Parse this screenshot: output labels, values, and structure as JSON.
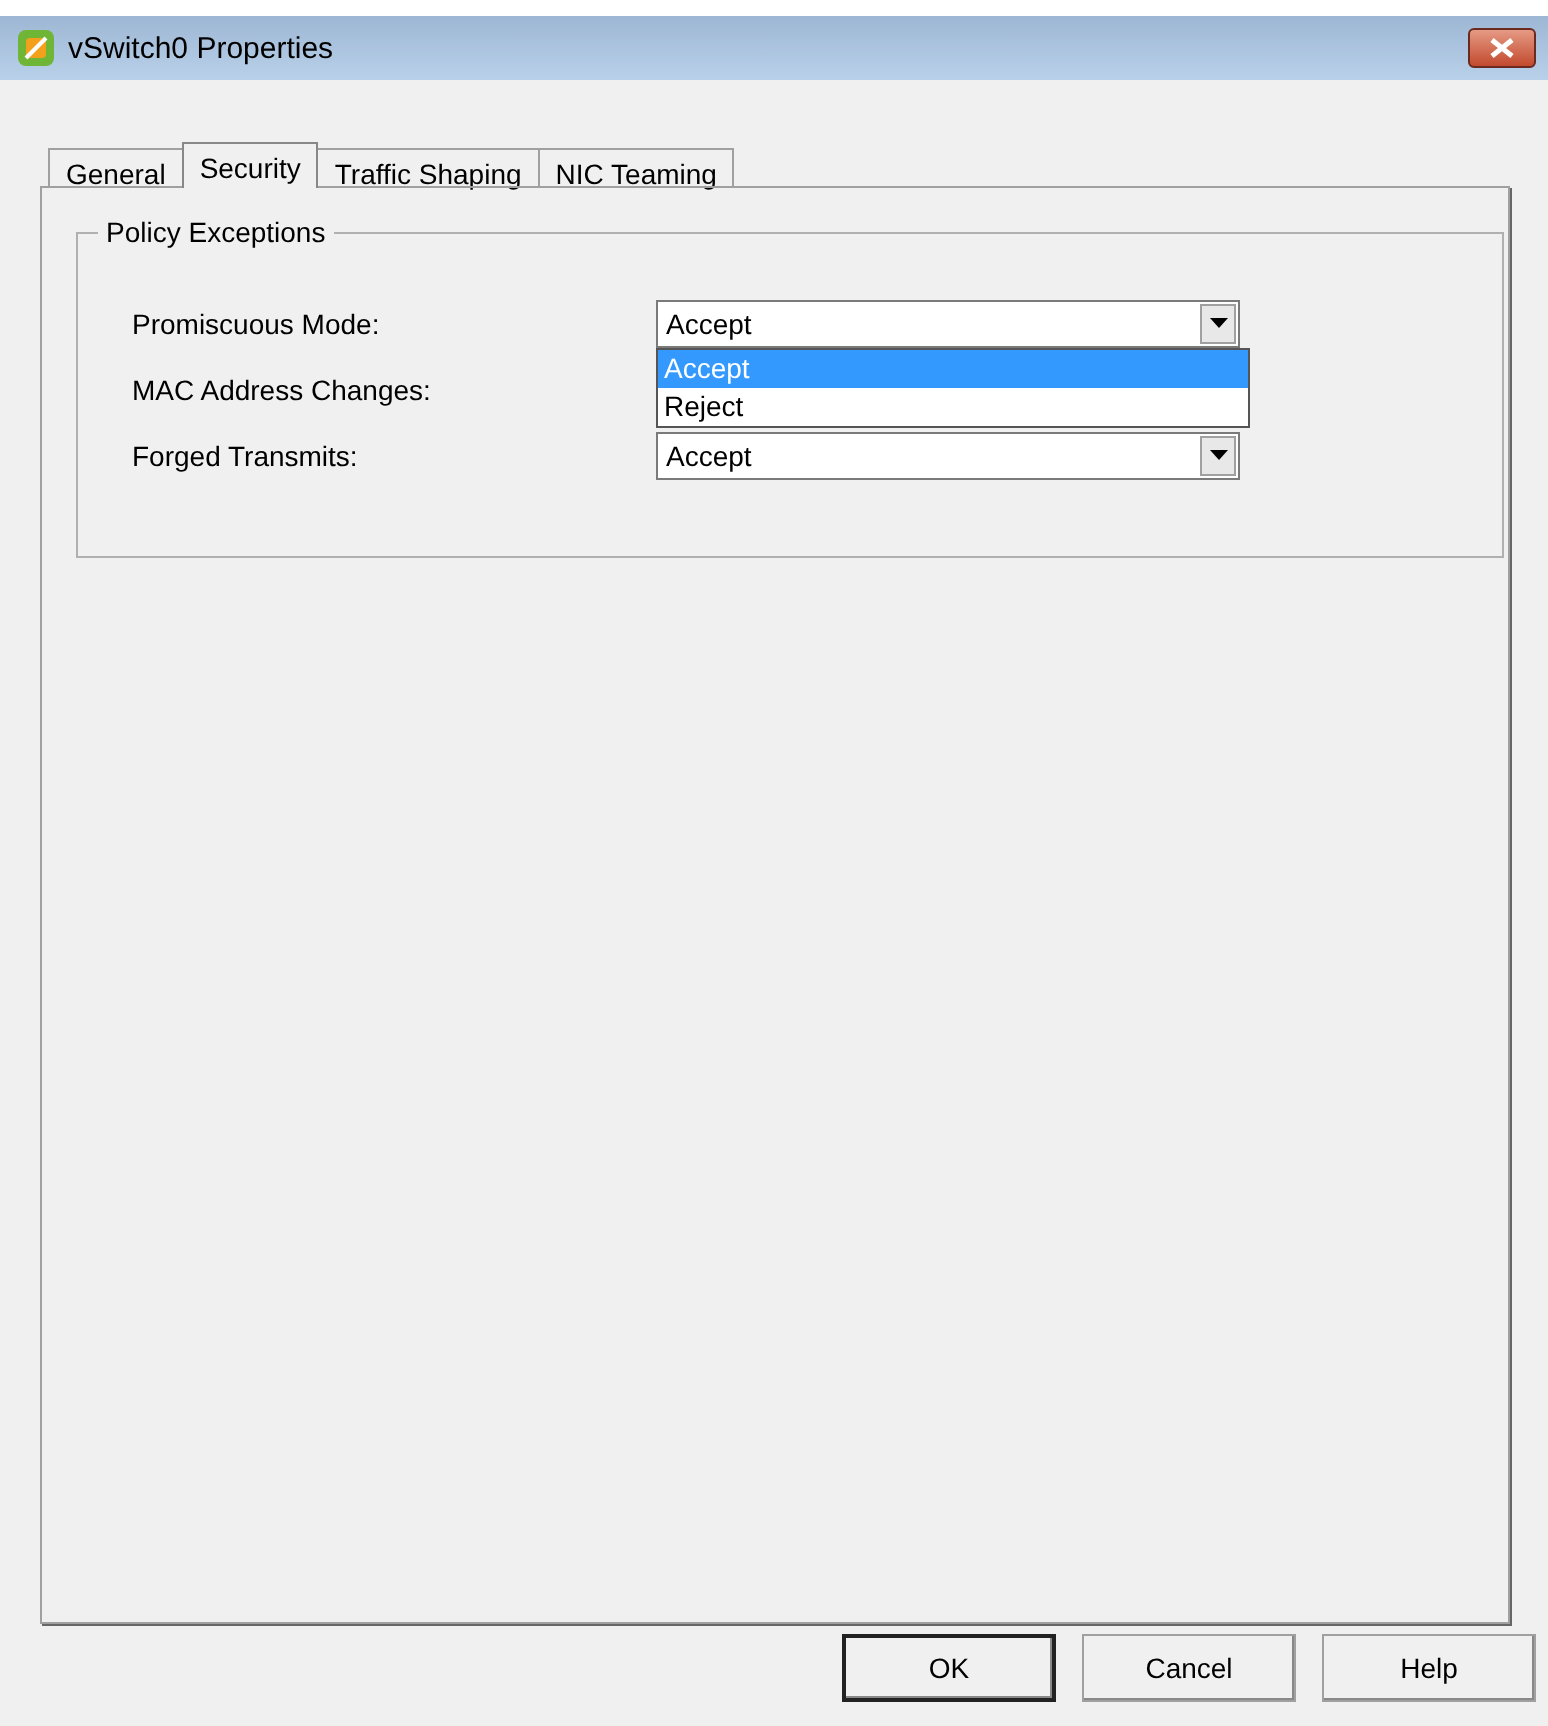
{
  "window": {
    "title": "vSwitch0 Properties"
  },
  "tabs": [
    {
      "label": "General",
      "selected": false
    },
    {
      "label": "Security",
      "selected": true
    },
    {
      "label": "Traffic Shaping",
      "selected": false
    },
    {
      "label": "NIC Teaming",
      "selected": false
    }
  ],
  "group": {
    "title": "Policy Exceptions",
    "fields": [
      {
        "label": "Promiscuous Mode:",
        "value": "Accept",
        "options": [
          {
            "label": "Accept",
            "selected": true
          },
          {
            "label": "Reject",
            "selected": false
          }
        ]
      },
      {
        "label": "MAC Address Changes:"
      },
      {
        "label": "Forged Transmits:",
        "value": "Accept"
      }
    ]
  },
  "buttons": [
    {
      "label": "OK",
      "default": true
    },
    {
      "label": "Cancel",
      "default": false
    },
    {
      "label": "Help",
      "default": false
    }
  ]
}
